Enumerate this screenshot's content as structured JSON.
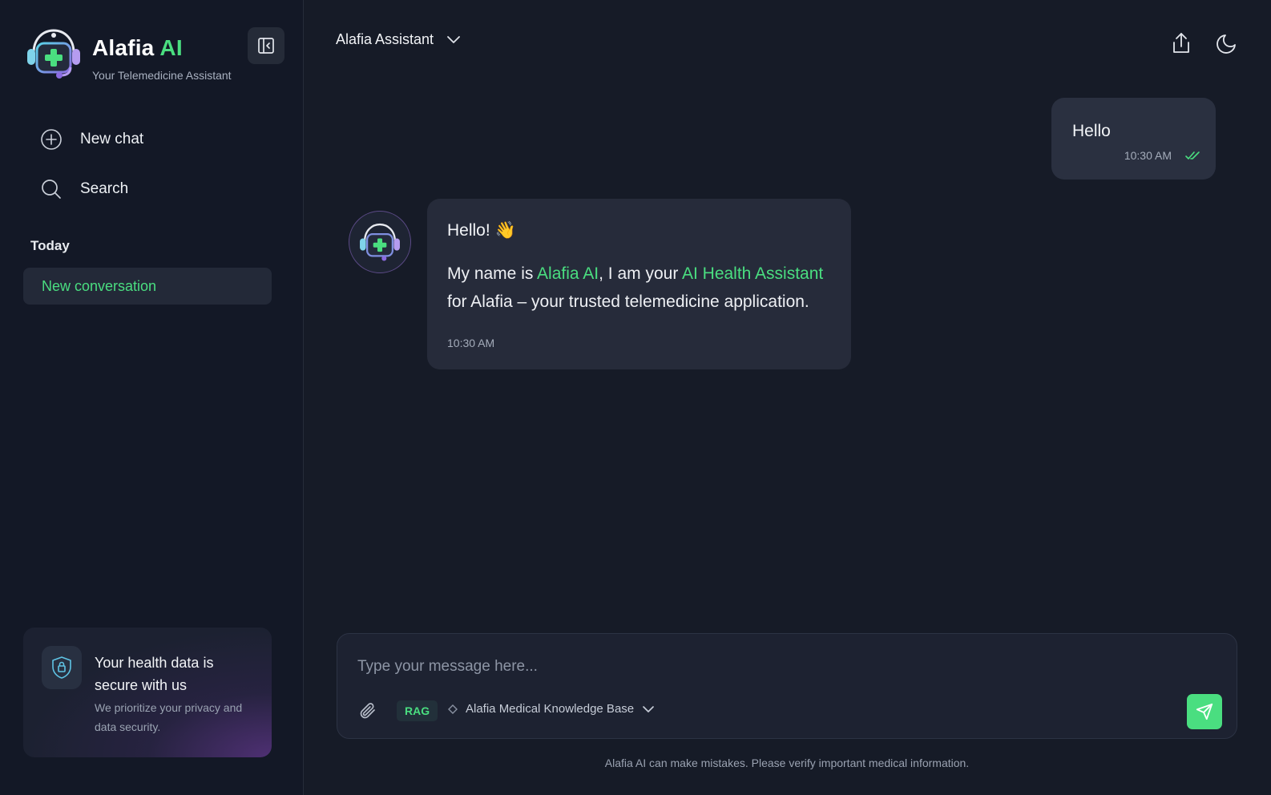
{
  "app": {
    "name": "Alafia",
    "name_accent": "AI",
    "subtitle": "Your Telemedicine Assistant"
  },
  "sidebar": {
    "nav": [
      {
        "label": "New chat",
        "icon": "plus-circle-icon"
      },
      {
        "label": "Search",
        "icon": "search-icon"
      }
    ],
    "section_label": "Today",
    "conversations": [
      {
        "label": "New conversation",
        "active": true
      }
    ],
    "secure_card": {
      "title": "Your health data is secure with us",
      "text": "We prioritize your privacy and data security."
    }
  },
  "header": {
    "model_label": "Alafia Assistant"
  },
  "messages": [
    {
      "role": "user",
      "text": "Hello",
      "time": "10:30 AM",
      "status": "read"
    },
    {
      "role": "assistant",
      "greeting": "Hello! 👋",
      "parts": [
        "My name is ",
        "Alafia AI",
        ", I am your ",
        "AI Health Assistant",
        " for Alafia – your trusted telemedicine application."
      ],
      "time": "10:30 AM"
    }
  ],
  "composer": {
    "placeholder": "Type your message here...",
    "badge": "RAG",
    "knowledge_base": "Alafia Medical Knowledge Base"
  },
  "footer": {
    "disclaimer": "Alafia AI can make mistakes. Please verify important medical information."
  },
  "colors": {
    "accent": "#4ade80",
    "background": "#161b27",
    "sidebar": "#131826"
  }
}
